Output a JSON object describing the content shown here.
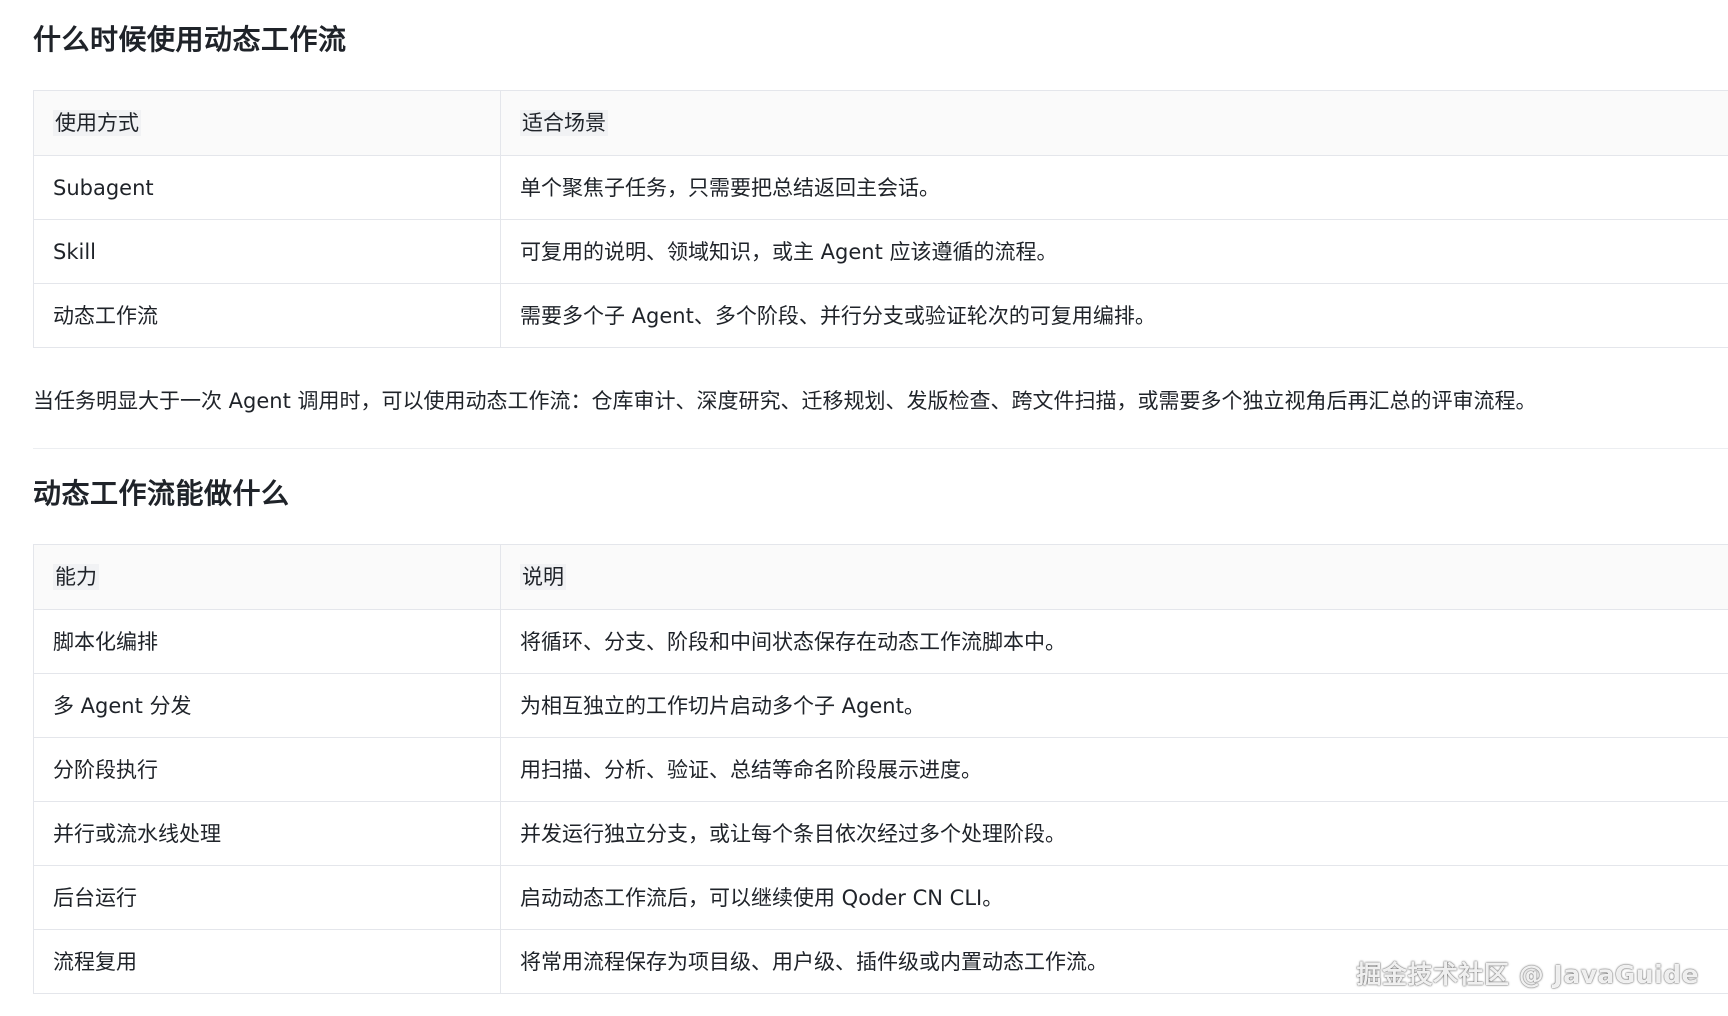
{
  "section1": {
    "heading": "什么时候使用动态工作流",
    "table": {
      "headers": [
        "使用方式",
        "适合场景"
      ],
      "rows": [
        [
          "Subagent",
          "单个聚焦子任务，只需要把总结返回主会话。"
        ],
        [
          "Skill",
          "可复用的说明、领域知识，或主 Agent 应该遵循的流程。"
        ],
        [
          "动态工作流",
          "需要多个子 Agent、多个阶段、并行分支或验证轮次的可复用编排。"
        ]
      ]
    },
    "paragraph": "当任务明显大于一次 Agent 调用时，可以使用动态工作流：仓库审计、深度研究、迁移规划、发版检查、跨文件扫描，或需要多个独立视角后再汇总的评审流程。"
  },
  "section2": {
    "heading": "动态工作流能做什么",
    "table": {
      "headers": [
        "能力",
        "说明"
      ],
      "rows": [
        [
          "脚本化编排",
          "将循环、分支、阶段和中间状态保存在动态工作流脚本中。"
        ],
        [
          "多 Agent 分发",
          "为相互独立的工作切片启动多个子 Agent。"
        ],
        [
          "分阶段执行",
          "用扫描、分析、验证、总结等命名阶段展示进度。"
        ],
        [
          "并行或流水线处理",
          "并发运行独立分支，或让每个条目依次经过多个处理阶段。"
        ],
        [
          "后台运行",
          "启动动态工作流后，可以继续使用 Qoder CN CLI。"
        ],
        [
          "流程复用",
          "将常用流程保存为项目级、用户级、插件级或内置动态工作流。"
        ]
      ]
    }
  },
  "watermark": "掘金技术社区 @ JavaGuide"
}
